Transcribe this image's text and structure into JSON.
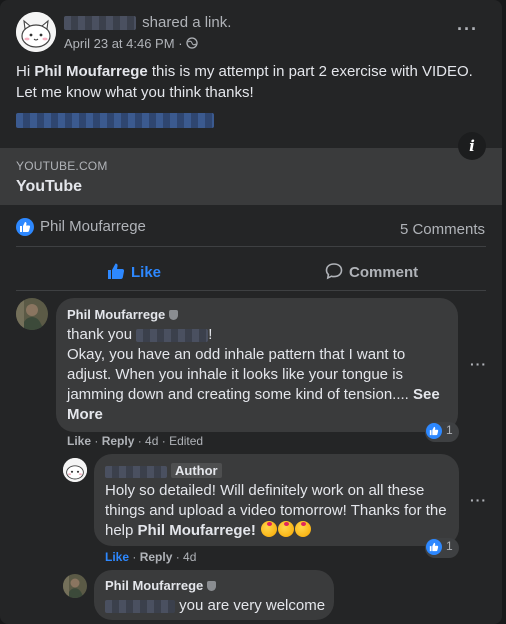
{
  "post": {
    "shared_text": "shared a link.",
    "date": "April 23 at 4:46 PM",
    "privacy_sep": "·",
    "text_hi": "Hi",
    "mention": "Phil Moufarrege",
    "text_rest": "this is my attempt in part 2 exercise with VIDEO. Let me know what you think thanks!",
    "preview_domain": "YOUTUBE.COM",
    "preview_title": "YouTube",
    "info_icon": "i"
  },
  "reactions": {
    "reactor": "Phil Moufarrege",
    "comments_count": "5 Comments"
  },
  "actions": {
    "like_label": "Like",
    "comment_label": "Comment"
  },
  "comments": [
    {
      "author": "Phil Moufarrege",
      "greeting": "thank you",
      "greeting_end": "!",
      "text": "Okay, you have an odd inhale pattern that I want to adjust. When you inhale it looks like your tongue is jamming down and creating some kind of tension....",
      "see_more": "See More",
      "like": "Like",
      "reply": "Reply",
      "time": "4d",
      "edited": "Edited",
      "reaction_count": "1"
    },
    {
      "author_badge": "Author",
      "text": "Holy so detailed! Will definitely work on all these things and upload a video tomorrow! Thanks for the help",
      "mention": "Phil Moufarrege!",
      "like": "Like",
      "reply": "Reply",
      "time": "4d",
      "reaction_count": "1"
    },
    {
      "author": "Phil Moufarrege",
      "text": "you are very welcome"
    }
  ],
  "colors": {
    "background": "#242526",
    "bubble": "#3a3b3c",
    "accent": "#2d88ff",
    "text": "#e4e6eb",
    "muted": "#b0b3b8"
  },
  "icons": [
    "more-icon",
    "globe-icon",
    "info-icon",
    "like-badge-icon",
    "thumbs-up-icon",
    "comment-icon",
    "shield-icon",
    "emoji-icon"
  ]
}
